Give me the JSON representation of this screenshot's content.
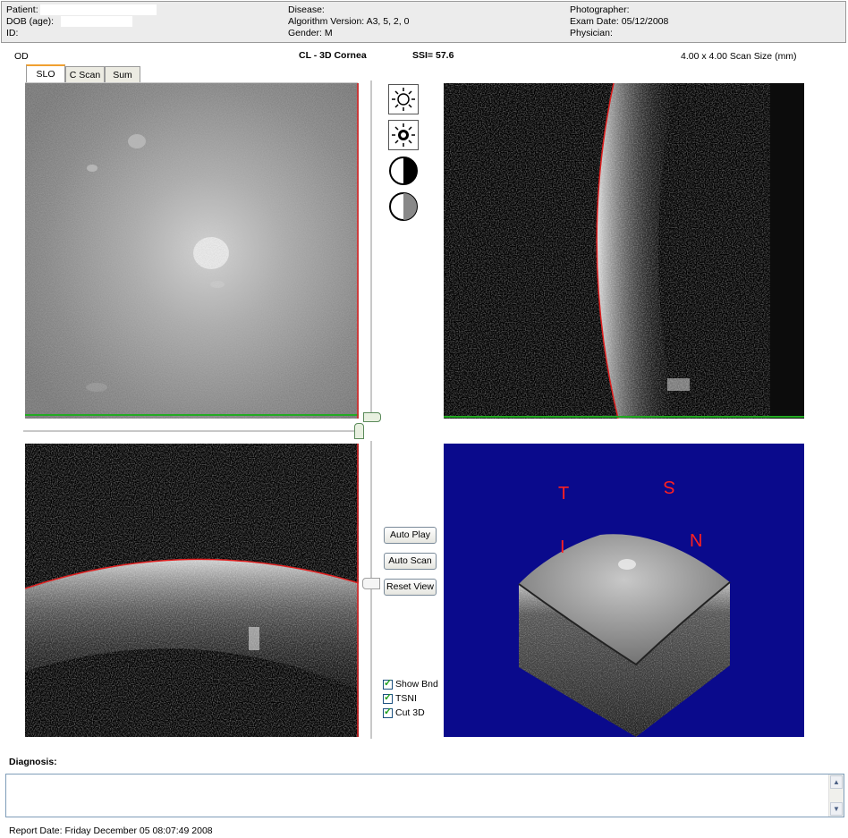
{
  "header": {
    "col1": [
      {
        "label": "Patient:",
        "value": ""
      },
      {
        "label": "DOB (age):",
        "value": ""
      },
      {
        "label": "ID:",
        "value": ""
      }
    ],
    "col2": [
      {
        "label": "Disease:",
        "value": ""
      },
      {
        "label": "Algorithm Version:",
        "value": "A3, 5, 2, 0"
      },
      {
        "label": "Gender:",
        "value": "M"
      }
    ],
    "col3": [
      {
        "label": "Photographer:",
        "value": ""
      },
      {
        "label": "Exam Date:",
        "value": "05/12/2008"
      },
      {
        "label": "Physician:",
        "value": ""
      }
    ]
  },
  "scan": {
    "eye": "OD",
    "protocol": "CL - 3D Cornea",
    "ssi": "SSI= 57.6",
    "scan_size": "4.00 x 4.00 Scan Size (mm)"
  },
  "tabs": [
    {
      "label": "SLO",
      "active": true
    },
    {
      "label": "C Scan",
      "active": false
    },
    {
      "label": "Sum",
      "active": false
    }
  ],
  "tools": [
    "brightness-increase-icon",
    "brightness-decrease-icon",
    "contrast-increase-icon",
    "contrast-decrease-icon"
  ],
  "buttons": {
    "auto_play": "Auto Play",
    "auto_scan": "Auto Scan",
    "reset_view": "Reset View"
  },
  "options": [
    {
      "label": "Show Bnd",
      "checked": true
    },
    {
      "label": "TSNI",
      "checked": true
    },
    {
      "label": "Cut 3D",
      "checked": true
    }
  ],
  "view3d": {
    "background": "#0a0a8c",
    "labels": {
      "T": "T",
      "S": "S",
      "I": "I",
      "N": "N"
    },
    "label_color": "#ff2020"
  },
  "diagnosis": {
    "label": "Diagnosis:",
    "text": ""
  },
  "report": {
    "date": "Report Date: Friday December 05 08:07:49 2008"
  },
  "colors": {
    "boundary": "#e02020",
    "position_line": "#22aa22"
  }
}
